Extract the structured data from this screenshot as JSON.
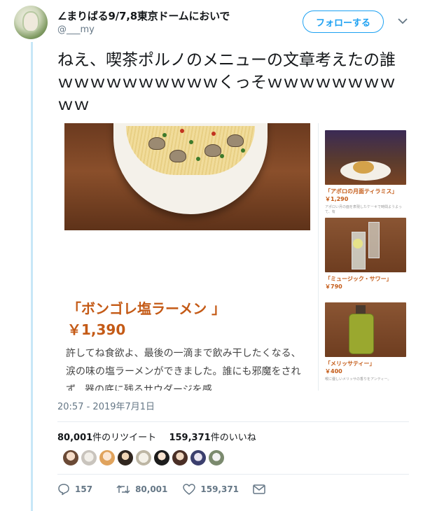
{
  "user": {
    "display_name": "∠まりばる9/7,8東京ドームにおいで",
    "handle": "@___my"
  },
  "follow_button": {
    "label": "フォローする"
  },
  "tweet": {
    "text": "ねえ、喫茶ポルノのメニューの文章考えたの誰ｗｗｗｗｗｗｗｗｗｗくっそｗｗｗｗｗｗｗｗｗｗ"
  },
  "media": {
    "main_dish": {
      "title": "「ボンゴレ塩ラーメン 」",
      "price": "￥1,390",
      "description": "許してね食欲よ、最後の一滴まで飲み干したくなる、涙の味の塩ラーメンができました。誰にも邪魔をされず、器の底に残るサウダージを感"
    },
    "side_items": [
      {
        "title": "「アポロの月面ティラミス」",
        "price": "￥1,290",
        "note": "アポロい月の面を表現したケーキで時間ようよって、有"
      },
      {
        "title": "「ミュージック・サワー」",
        "price": "￥790",
        "note": ""
      },
      {
        "title": "「メリッサティー」",
        "price": "￥400",
        "note": "喉に優しいメリッサの香りをアンティー。"
      }
    ],
    "colors": {
      "menu_accent": "#c45a16",
      "wood": "#7a4424"
    }
  },
  "timestamp": "20:57 - 2019年7月1日",
  "stats": {
    "retweets_count": "80,001",
    "retweets_label": "件のリツイート",
    "likes_count": "159,371",
    "likes_label": "件のいいね"
  },
  "actions": {
    "reply_count": "157",
    "retweet_count": "80,001",
    "like_count": "159,371"
  },
  "accent_color": "#1da1f2"
}
